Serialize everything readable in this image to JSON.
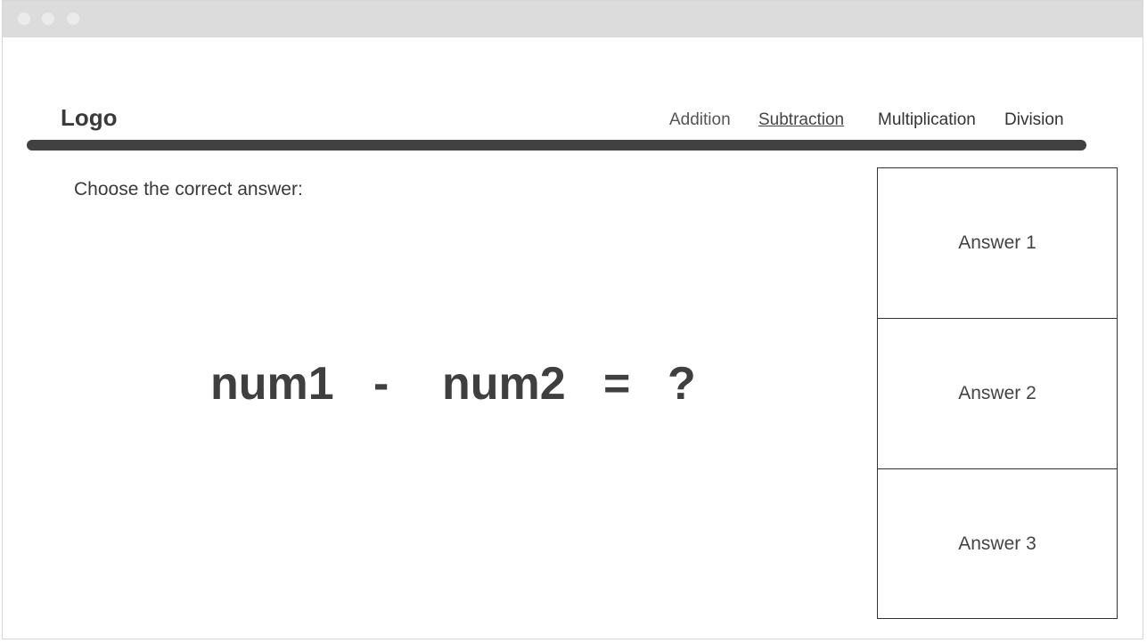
{
  "header": {
    "logo": "Logo",
    "nav": {
      "addition": "Addition",
      "subtraction": "Subtraction",
      "multiplication": "Multiplication",
      "division": "Division"
    },
    "active_tab": "Subtraction"
  },
  "main": {
    "instruction": "Choose the correct answer:",
    "equation": {
      "operand1": "num1",
      "operator": "-",
      "operand2": "num2",
      "equals": "=",
      "result": "?"
    }
  },
  "answers": [
    {
      "label": "Answer 1"
    },
    {
      "label": "Answer 2"
    },
    {
      "label": "Answer 3"
    }
  ],
  "colors": {
    "rule": "#414141",
    "text": "#3d3d3d",
    "titlebar": "#dcdcdc"
  }
}
